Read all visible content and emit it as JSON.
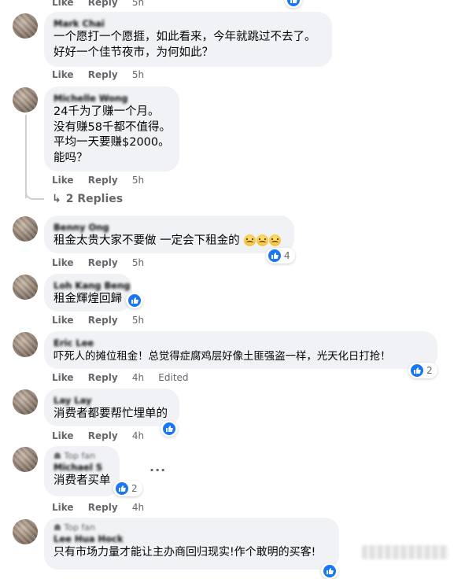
{
  "top_actions": {
    "like": "Like",
    "reply": "Reply",
    "time": "5h"
  },
  "comments": [
    {
      "name": "Mark Chai",
      "lines": [
        "一个愿打一个愿捱，如此看来，今年就跳过不去了。",
        "好好一个佳节夜市，为何如此？"
      ],
      "like": "Like",
      "reply": "Reply",
      "time": "5h"
    },
    {
      "name": "Michelle Wong",
      "lines": [
        "24千为了赚一个月。",
        "没有赚58千都不值得。",
        "平均一天要赚$2000。",
        "能吗？"
      ],
      "like": "Like",
      "reply": "Reply",
      "time": "5h",
      "replies_label": "2 Replies"
    },
    {
      "name": "Benny Ong",
      "lines": [
        "租金太贵大家不要做 一定会下租金的"
      ],
      "like": "Like",
      "reply": "Reply",
      "time": "5h",
      "reaction_count": "4"
    },
    {
      "name": "Loh Kang Beng",
      "lines": [
        "租金輝煌回歸"
      ],
      "like": "Like",
      "reply": "Reply",
      "time": "5h"
    },
    {
      "name": "Eric Lee",
      "lines": [
        "吓死人的摊位租金！总觉得症腐鸡层好像土匪强盗一样，光天化日打抢！"
      ],
      "like": "Like",
      "reply": "Reply",
      "time": "4h",
      "edited": "Edited",
      "reaction_count": "2"
    },
    {
      "name": "Lay Lay",
      "lines": [
        "消费者都要帮忙埋单的"
      ],
      "like": "Like",
      "reply": "Reply",
      "time": "4h"
    },
    {
      "fan_label": "Top fan",
      "name": "Michael S",
      "lines": [
        "消费者买单"
      ],
      "like": "Like",
      "reply": "Reply",
      "time": "4h",
      "reaction_count": "2"
    },
    {
      "fan_label": "Top fan",
      "name": "Lee Hua Hock",
      "lines": [
        "只有市场力量才能让主办商回归现实!作个敢明的买客!"
      ]
    }
  ],
  "colors": {
    "like_blue": "#1877f2",
    "bubble": "#f0f2f5",
    "meta": "#65676b"
  },
  "icons": {
    "like": "thumbs-up-icon",
    "reply_arrow": "reply-arrow-icon",
    "more": "more-dots-icon",
    "fan": "top-fan-badge-icon"
  }
}
